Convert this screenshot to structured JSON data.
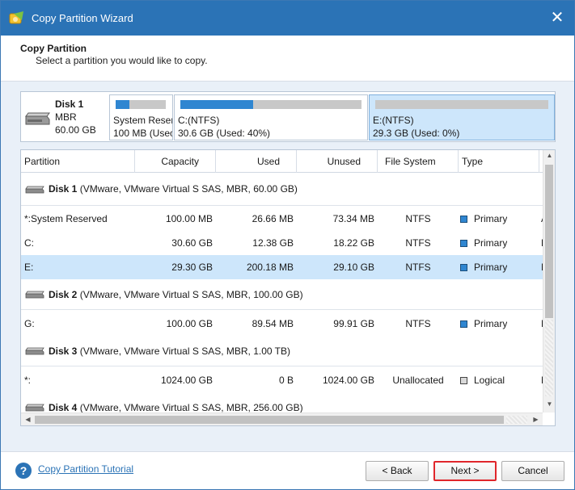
{
  "window": {
    "title": "Copy Partition Wizard",
    "close": "✕"
  },
  "header": {
    "title": "Copy Partition",
    "subtitle": "Select a partition you would like to copy."
  },
  "diskmap": {
    "disk": {
      "name": "Disk 1",
      "type": "MBR",
      "size": "60.00 GB"
    },
    "partitions": [
      {
        "label": "System Reser",
        "info": "100 MB (Usec",
        "used_fraction": 0.27,
        "selected": false
      },
      {
        "label": "C:(NTFS)",
        "info": "30.6 GB (Used: 40%)",
        "used_fraction": 0.4,
        "selected": false
      },
      {
        "label": "E:(NTFS)",
        "info": "29.3 GB (Used: 0%)",
        "used_fraction": 0.0,
        "selected": true
      }
    ]
  },
  "table": {
    "columns": [
      "Partition",
      "Capacity",
      "Used",
      "Unused",
      "File System",
      "Type",
      "S"
    ],
    "disks": [
      {
        "name": "Disk 1",
        "detail": "(VMware, VMware Virtual S SAS, MBR, 60.00 GB)"
      },
      {
        "name": "Disk 2",
        "detail": "(VMware, VMware Virtual S SAS, MBR, 100.00 GB)"
      },
      {
        "name": "Disk 3",
        "detail": "(VMware, VMware Virtual S SAS, MBR, 1.00 TB)"
      },
      {
        "name": "Disk 4",
        "detail": "(VMware, VMware Virtual S SAS, MBR, 256.00 GB)"
      }
    ],
    "rows": [
      {
        "partition": "*:System Reserved",
        "capacity": "100.00 MB",
        "used": "26.66 MB",
        "unused": "73.34 MB",
        "fs": "NTFS",
        "type": "Primary",
        "status": "A"
      },
      {
        "partition": "C:",
        "capacity": "30.60 GB",
        "used": "12.38 GB",
        "unused": "18.22 GB",
        "fs": "NTFS",
        "type": "Primary",
        "status": "B"
      },
      {
        "partition": "E:",
        "capacity": "29.30 GB",
        "used": "200.18 MB",
        "unused": "29.10 GB",
        "fs": "NTFS",
        "type": "Primary",
        "status": "N"
      },
      {
        "partition": "G:",
        "capacity": "100.00 GB",
        "used": "89.54 MB",
        "unused": "99.91 GB",
        "fs": "NTFS",
        "type": "Primary",
        "status": "N"
      },
      {
        "partition": "*:",
        "capacity": "1024.00 GB",
        "used": "0 B",
        "unused": "1024.00 GB",
        "fs": "Unallocated",
        "type": "Logical",
        "status": "N"
      }
    ]
  },
  "colors": {
    "primary_square": "#2f86d1",
    "logical_square": "#d9d9d9",
    "accent": "#2b73b6",
    "selection": "#cde6fb",
    "next_outline": "#e0262b"
  },
  "footer": {
    "help_link": "Copy Partition Tutorial",
    "back_label": "< Back",
    "next_label": "Next >",
    "cancel_label": "Cancel"
  }
}
